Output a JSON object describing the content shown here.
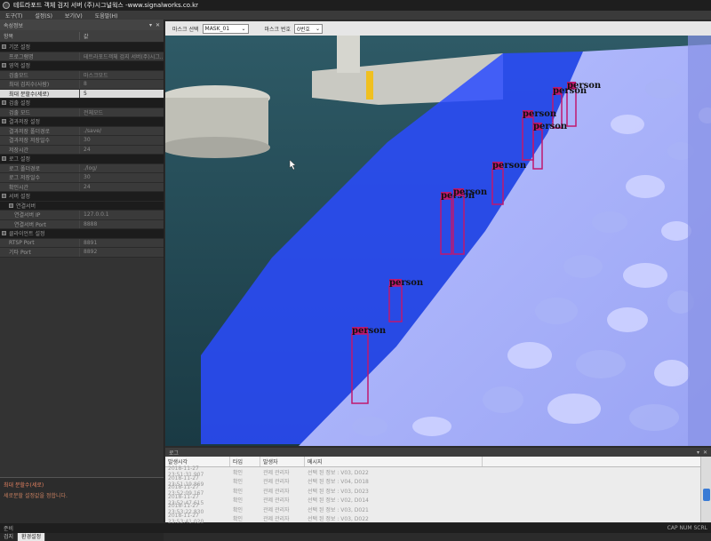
{
  "window": {
    "title": "테트라포드 객체 검지 서버 (주)시그널웍스 -www.signalworks.co.kr"
  },
  "menubar": {
    "items": [
      "도구(T)",
      "설정(S)",
      "보기(V)",
      "도움말(H)"
    ]
  },
  "left_panel": {
    "title": "속성정보",
    "col_name": "항목",
    "col_value": "값",
    "rows": [
      {
        "type": "cat",
        "k": "기본 설정",
        "v": ""
      },
      {
        "type": "item",
        "k": "프로그램명",
        "v": "테트라포드객체 검지 서버(주)시그..."
      },
      {
        "type": "cat",
        "k": "영역 설정",
        "v": ""
      },
      {
        "type": "item",
        "k": "검출모드",
        "v": "마스크모드"
      },
      {
        "type": "item",
        "k": "최대 검지수(사람)",
        "v": "8"
      },
      {
        "type": "item",
        "k": "최대 분할수(세로)",
        "v": "5",
        "state": "sel"
      },
      {
        "type": "cat",
        "k": "검출 설정",
        "v": ""
      },
      {
        "type": "item",
        "k": "검출 모드",
        "v": "전체모드"
      },
      {
        "type": "cat",
        "k": "결과저장 설정",
        "v": ""
      },
      {
        "type": "item",
        "k": "결과저장 폴더경로",
        "v": "./save/"
      },
      {
        "type": "item",
        "k": "결과저장 저장일수",
        "v": "30"
      },
      {
        "type": "item",
        "k": "저장시간",
        "v": "24"
      },
      {
        "type": "cat",
        "k": "로그 설정",
        "v": ""
      },
      {
        "type": "item",
        "k": "로그 폴더경로",
        "v": "./log/"
      },
      {
        "type": "item",
        "k": "로그 저장일수",
        "v": "30"
      },
      {
        "type": "item",
        "k": "확인시간",
        "v": "24"
      },
      {
        "type": "cat",
        "k": "서버 설정",
        "v": ""
      },
      {
        "type": "subcat",
        "k": "연결서버",
        "v": ""
      },
      {
        "type": "sub",
        "k": "연결서버 IP",
        "v": "127.0.0.1"
      },
      {
        "type": "sub",
        "k": "연결서버 Port",
        "v": "8888"
      },
      {
        "type": "cat",
        "k": "클라이언트 설정",
        "v": ""
      },
      {
        "type": "item",
        "k": "RTSP Port",
        "v": "8891"
      },
      {
        "type": "item",
        "k": "기타 Port",
        "v": "8892"
      }
    ],
    "desc_title": "최대 분할수(세로)",
    "desc_text": "세로분할 설정값을 정합니다.",
    "tabs": [
      "검지",
      "환경설정"
    ]
  },
  "toolbar": {
    "mask_label": "마스크 선택",
    "mask_value": "MASK_01",
    "mask_num_label": "마스크 번호",
    "mask_num_value": "0번호"
  },
  "detections": {
    "label": "person",
    "colors": {
      "box": "#c0186e",
      "mask": "#2a4bff"
    },
    "count": 9
  },
  "event_log": {
    "title": "로그",
    "columns": [
      "발생시각",
      "타입",
      "발생자",
      "메시지"
    ],
    "rows": [
      {
        "time": "2018-11-27 23:51:31.907",
        "type": "확인",
        "who": "관제 관리자",
        "msg": "선택 된 정보 : V03, D022"
      },
      {
        "time": "2018-11-27 23:51:19.869",
        "type": "확인",
        "who": "관제 관리자",
        "msg": "선택 된 정보 : V04, D018"
      },
      {
        "time": "2018-11-27 23:52:09.167",
        "type": "확인",
        "who": "관제 관리자",
        "msg": "선택 된 정보 : V03, D023"
      },
      {
        "time": "2018-11-27 23:52:47.615",
        "type": "확인",
        "who": "관제 관리자",
        "msg": "선택 된 정보 : V02, D014"
      },
      {
        "time": "2018-11-27 23:53:22.830",
        "type": "확인",
        "who": "관제 관리자",
        "msg": "선택 된 정보 : V03, D021"
      },
      {
        "time": "2018-11-27 23:53:41.020",
        "type": "확인",
        "who": "관제 관리자",
        "msg": "선택 된 정보 : V03, D022"
      }
    ]
  },
  "statusbar": {
    "left": "준비",
    "right": "CAP NUM SCRL"
  }
}
